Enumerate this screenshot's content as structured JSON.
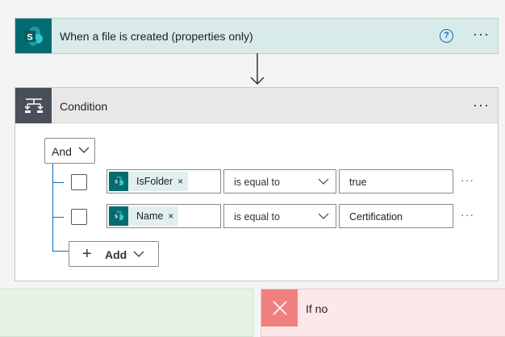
{
  "trigger": {
    "title": "When a file is created (properties only)",
    "icon": "sharepoint-icon",
    "help_icon": "?",
    "more": "···"
  },
  "condition": {
    "title": "Condition",
    "icon": "condition-icon",
    "more": "···",
    "group_operator": "And",
    "rows": [
      {
        "token": "IsFolder",
        "token_remove": "×",
        "operator": "is equal to",
        "value": "true",
        "more": "···"
      },
      {
        "token": "Name",
        "token_remove": "×",
        "operator": "is equal to",
        "value": "Certification",
        "more": "···"
      }
    ],
    "add_button": {
      "label": "Add",
      "plus": "+"
    }
  },
  "branches": {
    "no": {
      "title": "If no",
      "icon": "close-icon"
    }
  },
  "colors": {
    "sharepoint": "#036c70",
    "trigger_bg": "#d8eaea",
    "condition_icon_bg": "#484f58",
    "accent": "#0f6cbd",
    "yes_bg": "#e6f4e6",
    "no_bg": "#fde7e9",
    "no_icon_bg": "#f08080"
  }
}
